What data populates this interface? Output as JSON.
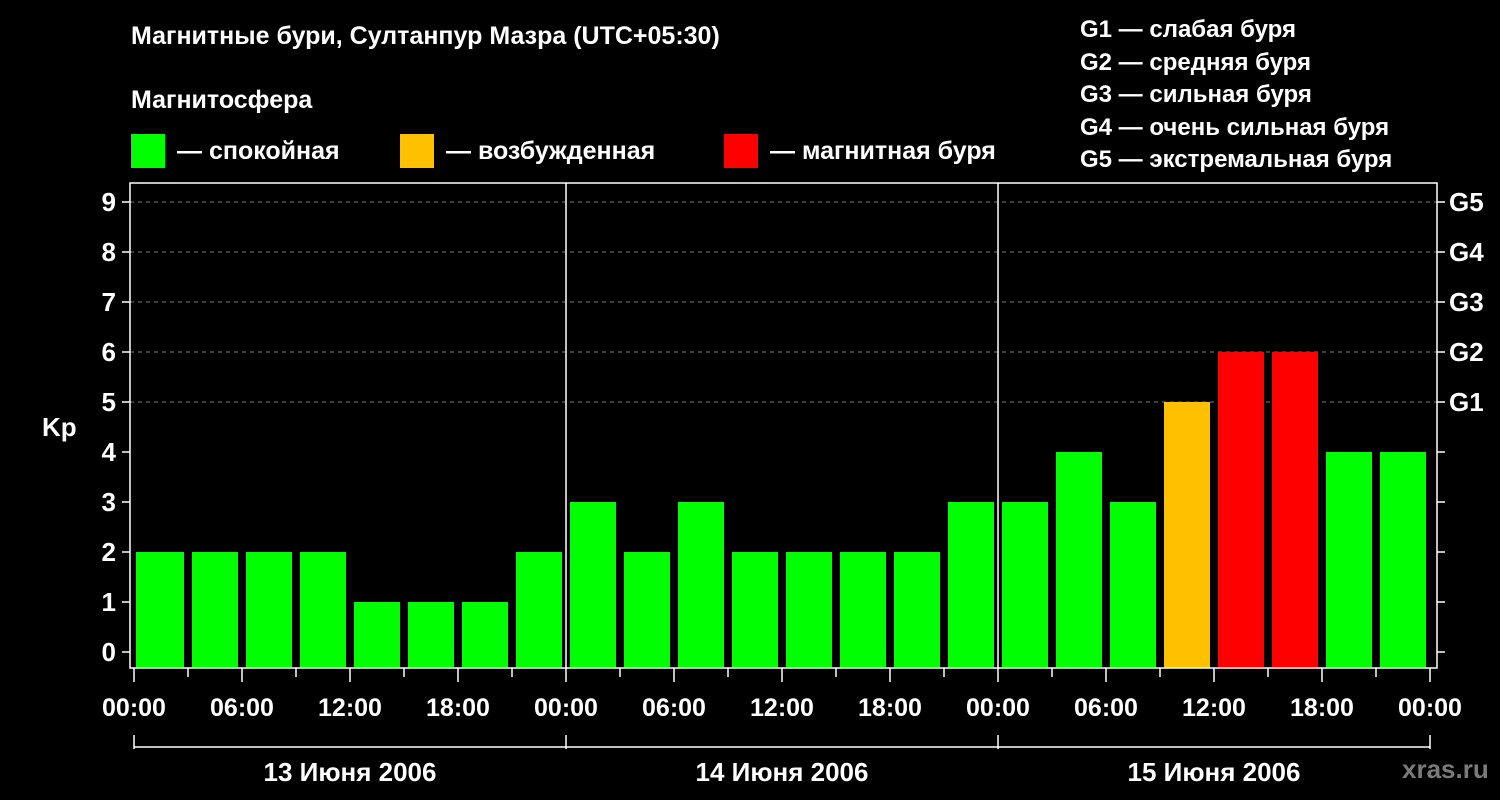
{
  "title": "Магнитные бури, Султанпур Мазра (UTC+05:30)",
  "subtitle": "Магнитосфера",
  "legend": [
    {
      "label": "— спокойная",
      "color": "#00ff00"
    },
    {
      "label": "— возбужденная",
      "color": "#ffc000"
    },
    {
      "label": "— магнитная буря",
      "color": "#ff0000"
    }
  ],
  "storm_levels": [
    "G1 — слабая буря",
    "G2 — средняя буря",
    "G3 — сильная буря",
    "G4 — очень сильная буря",
    "G5 — экстремальная буря"
  ],
  "watermark": "xras.ru",
  "chart_data": {
    "type": "bar",
    "ylabel": "Kp",
    "ylim": [
      0,
      9
    ],
    "y_ticks": [
      "0",
      "1",
      "2",
      "3",
      "4",
      "5",
      "6",
      "7",
      "8",
      "9"
    ],
    "right_ticks": [
      {
        "kp": 5,
        "label": "G1"
      },
      {
        "kp": 6,
        "label": "G2"
      },
      {
        "kp": 7,
        "label": "G3"
      },
      {
        "kp": 8,
        "label": "G4"
      },
      {
        "kp": 9,
        "label": "G5"
      }
    ],
    "x_tick_labels": [
      "00:00",
      "06:00",
      "12:00",
      "18:00",
      "00:00",
      "06:00",
      "12:00",
      "18:00",
      "00:00",
      "06:00",
      "12:00",
      "18:00",
      "00:00"
    ],
    "days": [
      "13 Июня 2006",
      "14 Июня 2006",
      "15 Июня 2006"
    ],
    "grid": "dashed horizontal at Kp 5–9",
    "colors": {
      "quiet": "#00ff00",
      "active": "#ffc000",
      "storm": "#ff0000"
    },
    "bars": [
      {
        "start": "13 Июня 2006 00:00",
        "kp": 1,
        "level": "quiet"
      },
      {
        "start": "13 Июня 2006 03:00",
        "kp": 1,
        "level": "quiet"
      },
      {
        "start": "13 Июня 2006 06:00",
        "kp": 1,
        "level": "quiet"
      },
      {
        "start": "13 Июня 2006 09:00",
        "kp": 1,
        "level": "quiet"
      },
      {
        "start": "13 Июня 2006 12:00",
        "kp": 0,
        "level": "quiet"
      },
      {
        "start": "13 Июня 2006 15:00",
        "kp": 0,
        "level": "quiet"
      },
      {
        "start": "13 Июня 2006 18:00",
        "kp": 0,
        "level": "quiet"
      },
      {
        "start": "13 Июня 2006 21:00",
        "kp": 1,
        "level": "quiet"
      },
      {
        "start": "14 Июня 2006 00:00",
        "kp": 2,
        "level": "quiet"
      },
      {
        "start": "14 Июня 2006 03:00",
        "kp": 1,
        "level": "quiet"
      },
      {
        "start": "14 Июня 2006 06:00",
        "kp": 2,
        "level": "quiet"
      },
      {
        "start": "14 Июня 2006 09:00",
        "kp": 1,
        "level": "quiet"
      },
      {
        "start": "14 Июня 2006 12:00",
        "kp": 1,
        "level": "quiet"
      },
      {
        "start": "14 Июня 2006 15:00",
        "kp": 1,
        "level": "quiet"
      },
      {
        "start": "14 Июня 2006 18:00",
        "kp": 1,
        "level": "quiet"
      },
      {
        "start": "14 Июня 2006 21:00",
        "kp": 2,
        "level": "quiet"
      },
      {
        "start": "15 Июня 2006 00:00",
        "kp": 2,
        "level": "quiet"
      },
      {
        "start": "15 Июня 2006 03:00",
        "kp": 3,
        "level": "quiet"
      },
      {
        "start": "15 Июня 2006 06:00",
        "kp": 2,
        "level": "quiet"
      },
      {
        "start": "15 Июня 2006 09:00",
        "kp": 4,
        "level": "active"
      },
      {
        "start": "15 Июня 2006 12:00",
        "kp": 5,
        "level": "storm"
      },
      {
        "start": "15 Июня 2006 15:00",
        "kp": 5,
        "level": "storm"
      },
      {
        "start": "15 Июня 2006 18:00",
        "kp": 3,
        "level": "quiet"
      },
      {
        "start": "15 Июня 2006 21:00",
        "kp": 3,
        "level": "quiet"
      }
    ]
  }
}
